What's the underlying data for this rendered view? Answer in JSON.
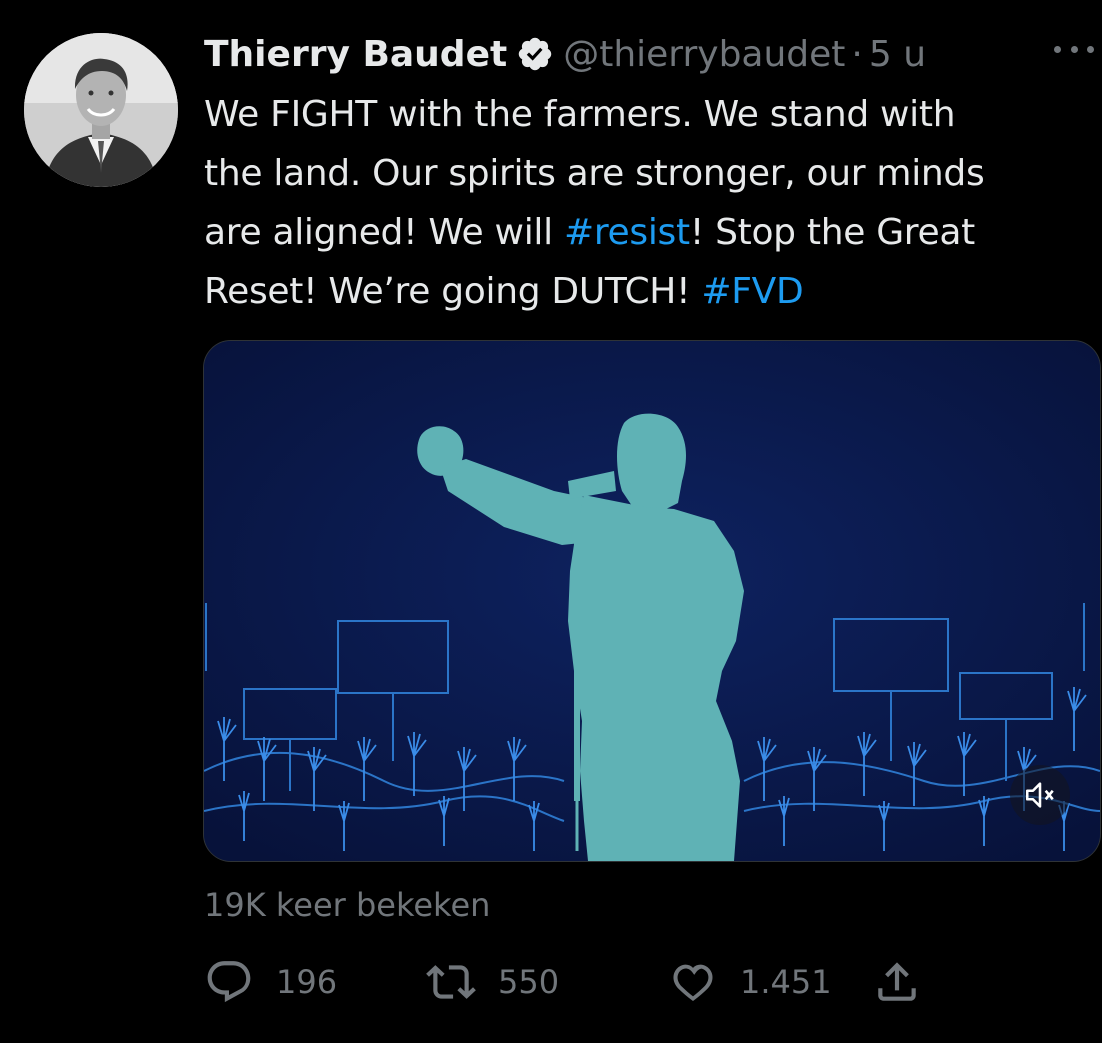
{
  "tweet": {
    "author_name": "Thierry Baudet",
    "handle": "@thierrybaudet",
    "separator": "·",
    "time": "5 u",
    "text_lines": [
      [
        {
          "t": "We FIGHT with the farmers. We stand with"
        }
      ],
      [
        {
          "t": "the land. Our spirits are stronger, our minds"
        }
      ],
      [
        {
          "t": "are aligned! We will "
        },
        {
          "t": "#resist",
          "tag": true
        },
        {
          "t": "! Stop the Great"
        }
      ],
      [
        {
          "t": "Reset! We’re going DUTCH! "
        },
        {
          "t": "#FVD",
          "tag": true
        }
      ]
    ],
    "views_label": "19K keer bekeken",
    "replies": "196",
    "retweets": "550",
    "likes": "1.451"
  },
  "icons": {
    "verified": "verified-badge-icon",
    "more": "more-options-icon",
    "mute": "volume-muted-icon",
    "reply": "reply-icon",
    "retweet": "retweet-icon",
    "like": "heart-icon",
    "share": "share-icon"
  },
  "colors": {
    "background": "#000000",
    "text": "#e7e9ea",
    "secondary": "#71767b",
    "hashtag": "#1d9bf0",
    "media_background": "#0b1a4a",
    "silhouette": "#5fb2b5",
    "crowd_lines": "#2f7fd6"
  }
}
